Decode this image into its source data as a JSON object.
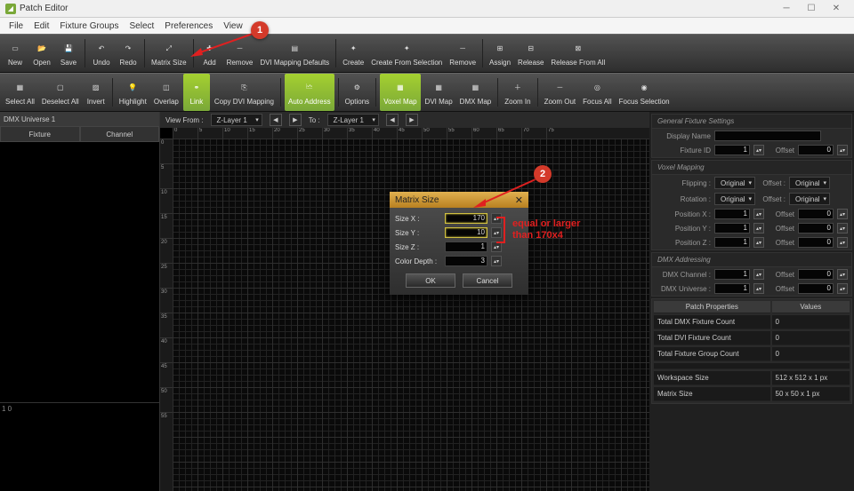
{
  "titlebar": {
    "title": "Patch Editor"
  },
  "menus": [
    "File",
    "Edit",
    "Fixture Groups",
    "Select",
    "Preferences",
    "View"
  ],
  "toolbar1": [
    {
      "id": "new",
      "label": "New"
    },
    {
      "id": "open",
      "label": "Open"
    },
    {
      "id": "save",
      "label": "Save"
    },
    {
      "id": "sep"
    },
    {
      "id": "undo",
      "label": "Undo"
    },
    {
      "id": "redo",
      "label": "Redo"
    },
    {
      "id": "sep"
    },
    {
      "id": "matrix-size",
      "label": "Matrix Size"
    },
    {
      "id": "sep"
    },
    {
      "id": "add",
      "label": "Add"
    },
    {
      "id": "remove",
      "label": "Remove"
    },
    {
      "id": "dvi-map-def",
      "label": "DVI Mapping Defaults"
    },
    {
      "id": "sep"
    },
    {
      "id": "create",
      "label": "Create"
    },
    {
      "id": "create-from-sel",
      "label": "Create From Selection"
    },
    {
      "id": "remove2",
      "label": "Remove"
    },
    {
      "id": "sep"
    },
    {
      "id": "assign",
      "label": "Assign"
    },
    {
      "id": "release",
      "label": "Release"
    },
    {
      "id": "release-all",
      "label": "Release From All"
    }
  ],
  "toolbar2": [
    {
      "id": "select-all",
      "label": "Select All"
    },
    {
      "id": "deselect-all",
      "label": "Deselect All"
    },
    {
      "id": "invert",
      "label": "Invert"
    },
    {
      "id": "sep"
    },
    {
      "id": "highlight",
      "label": "Highlight"
    },
    {
      "id": "overlap",
      "label": "Overlap"
    },
    {
      "id": "link",
      "label": "Link",
      "green": true
    },
    {
      "id": "copy-dvi",
      "label": "Copy DVI Mapping"
    },
    {
      "id": "sep"
    },
    {
      "id": "auto-addr",
      "label": "Auto Address",
      "green": true
    },
    {
      "id": "sep"
    },
    {
      "id": "options",
      "label": "Options"
    },
    {
      "id": "sep"
    },
    {
      "id": "voxel-map",
      "label": "Voxel Map",
      "green": true
    },
    {
      "id": "dvi-map",
      "label": "DVI Map"
    },
    {
      "id": "dmx-map",
      "label": "DMX Map"
    },
    {
      "id": "sep"
    },
    {
      "id": "zoom-in",
      "label": "Zoom In"
    },
    {
      "id": "sep"
    },
    {
      "id": "zoom-out",
      "label": "Zoom Out"
    },
    {
      "id": "focus-all",
      "label": "Focus All"
    },
    {
      "id": "focus-sel",
      "label": "Focus Selection"
    }
  ],
  "left": {
    "universe": "DMX Universe 1",
    "tabs": [
      "Fixture",
      "Channel"
    ],
    "mini": "1 0"
  },
  "view": {
    "label_from": "View From :",
    "layer_from": "Z-Layer 1",
    "label_to": "To :",
    "layer_to": "Z-Layer 1"
  },
  "dialog": {
    "title": "Matrix Size",
    "rows": [
      {
        "label": "Size X :",
        "value": "170"
      },
      {
        "label": "Size Y :",
        "value": "10"
      },
      {
        "label": "Size Z :",
        "value": "1"
      },
      {
        "label": "Color Depth :",
        "value": "3"
      }
    ],
    "ok": "OK",
    "cancel": "Cancel"
  },
  "right": {
    "general": {
      "title": "General Fixture Settings",
      "display": "Display Name",
      "fixid": "Fixture ID",
      "fixid_v": "1",
      "offset": "Offset",
      "offset_v": "0"
    },
    "voxel": {
      "title": "Voxel Mapping",
      "flipping": "Flipping :",
      "rotation": "Rotation :",
      "orig": "Original",
      "offset": "Offset :",
      "px": "Position X :",
      "px_v": "1",
      "px_o": "0",
      "py": "Position Y :",
      "py_v": "1",
      "py_o": "0",
      "pz": "Position Z :",
      "pz_v": "1",
      "pz_o": "0"
    },
    "dmx": {
      "title": "DMX Addressing",
      "chan": "DMX Channel :",
      "chan_v": "1",
      "chan_o": "0",
      "univ": "DMX Universe :",
      "univ_v": "1",
      "univ_o": "0"
    },
    "props": {
      "h1": "Patch Properties",
      "h2": "Values",
      "rows": [
        [
          "Total DMX Fixture Count",
          "0"
        ],
        [
          "Total DVI Fixture Count",
          "0"
        ],
        [
          "Total Fixture Group Count",
          "0"
        ],
        [
          "__gap",
          ""
        ],
        [
          "Workspace Size",
          "512 x 512 x 1 px"
        ],
        [
          "Matrix Size",
          "50 x 50 x 1 px"
        ]
      ]
    }
  },
  "annot": {
    "c1": "1",
    "c2": "2",
    "text1": "equal or larger",
    "text2": "than 170x4"
  }
}
